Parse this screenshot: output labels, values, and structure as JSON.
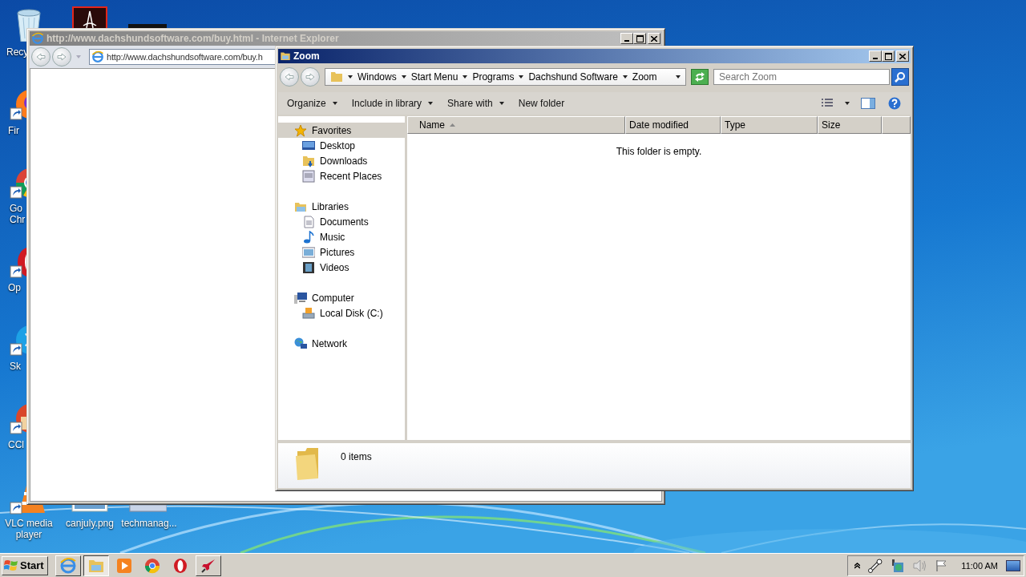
{
  "desktop": {
    "icons": [
      {
        "kind": "recycle-bin",
        "label": "Recy"
      },
      {
        "kind": "pdf-app"
      },
      {
        "kind": "dark-app"
      },
      {
        "kind": "firefox",
        "label": "Fir"
      },
      {
        "kind": "chrome",
        "label": "Go Chr"
      },
      {
        "kind": "opera",
        "label": "Op"
      },
      {
        "kind": "skype",
        "label": "Sk"
      },
      {
        "kind": "ccleaner",
        "label": "CCl"
      },
      {
        "kind": "vlc",
        "label": "VLC media player"
      },
      {
        "kind": "image-file",
        "label": "canjuly.png"
      },
      {
        "kind": "window-file",
        "label": "techmanag..."
      }
    ]
  },
  "browser_window": {
    "title": "http://www.dachshundsoftware.com/buy.html - Internet Explorer",
    "active": false,
    "address": "http://www.dachshundsoftware.com/buy.h"
  },
  "explorer_window": {
    "title": "Zoom",
    "active": true,
    "breadcrumb": [
      "Windows",
      "Start Menu",
      "Programs",
      "Dachshund Software",
      "Zoom"
    ],
    "search": {
      "placeholder": "Search Zoom"
    },
    "toolbar": [
      {
        "label": "Organize",
        "dropdown": true
      },
      {
        "label": "Include in library",
        "dropdown": true
      },
      {
        "label": "Share with",
        "dropdown": true
      },
      {
        "label": "New folder",
        "dropdown": false
      }
    ],
    "navigation": [
      {
        "label": "Favorites",
        "kind": "favorites",
        "selected": true,
        "children": [
          {
            "label": "Desktop",
            "kind": "desktop",
            "selected": false
          },
          {
            "label": "Downloads",
            "kind": "downloads",
            "selected": false
          },
          {
            "label": "Recent Places",
            "kind": "recent",
            "selected": false
          }
        ]
      },
      {
        "label": "Libraries",
        "kind": "libraries",
        "selected": false,
        "children": [
          {
            "label": "Documents",
            "kind": "documents",
            "selected": false
          },
          {
            "label": "Music",
            "kind": "music",
            "selected": false
          },
          {
            "label": "Pictures",
            "kind": "pictures",
            "selected": false
          },
          {
            "label": "Videos",
            "kind": "videos",
            "selected": false
          }
        ]
      },
      {
        "label": "Computer",
        "kind": "computer",
        "selected": false,
        "children": [
          {
            "label": "Local Disk (C:)",
            "kind": "disk",
            "selected": false
          }
        ]
      },
      {
        "label": "Network",
        "kind": "network",
        "selected": false
      }
    ],
    "columns": [
      {
        "label": "Name",
        "sorted": true
      },
      {
        "label": "Date modified",
        "sorted": false
      },
      {
        "label": "Type",
        "sorted": false
      },
      {
        "label": "Size",
        "sorted": false
      }
    ],
    "empty_message": "This folder is empty.",
    "item_count": "0 items"
  },
  "taskbar": {
    "start": "Start",
    "buttons": [
      {
        "kind": "ie",
        "running": true,
        "selected": false
      },
      {
        "kind": "explorer",
        "running": true,
        "selected": true
      },
      {
        "kind": "media",
        "running": false,
        "selected": false
      },
      {
        "kind": "chrome",
        "running": false,
        "selected": false
      },
      {
        "kind": "opera",
        "running": false,
        "selected": false
      },
      {
        "kind": "rocket",
        "running": true,
        "selected": false
      }
    ],
    "clock": "11:00 AM"
  }
}
